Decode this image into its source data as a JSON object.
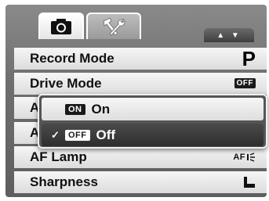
{
  "tabs": [
    {
      "icon": "camera-icon",
      "active": true
    },
    {
      "icon": "wrench-hammer-icon",
      "active": false
    }
  ],
  "scroll_indicator": "▲ ▼",
  "menu": [
    {
      "label": "Record Mode",
      "value_text": "P",
      "value_type": "text"
    },
    {
      "label": "Drive Mode",
      "value_text": "OFF",
      "value_type": "badge"
    },
    {
      "label": "A",
      "value_text": "",
      "value_type": "none"
    },
    {
      "label": "A",
      "value_text": "",
      "value_type": "none"
    },
    {
      "label": "AF Lamp",
      "value_text": "AF",
      "value_type": "af-lamp-icon"
    },
    {
      "label": "Sharpness",
      "value_text": "",
      "value_type": "sharpness-icon"
    }
  ],
  "popup": {
    "options": [
      {
        "badge": "ON",
        "label": "On",
        "selected": false
      },
      {
        "badge": "OFF",
        "label": "Off",
        "selected": true
      }
    ],
    "check_mark": "✓"
  },
  "colors": {
    "frame": "#6f6f6f",
    "row_light": "#ececec",
    "selected": "#333333",
    "text": "#111111"
  }
}
